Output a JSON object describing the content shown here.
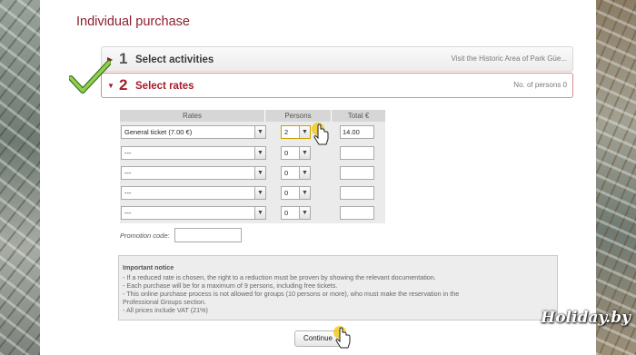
{
  "page_title": "Individual purchase",
  "steps": [
    {
      "number": "1",
      "title": "Select activities",
      "info": "Visit the Historic Area of Park Güe..."
    },
    {
      "number": "2",
      "title": "Select rates",
      "info": "No. of persons 0"
    }
  ],
  "rates_table": {
    "headers": {
      "rates": "Rates",
      "persons": "Persons",
      "total": "Total €"
    },
    "rows": [
      {
        "rate": "General ticket (7.00 €)",
        "persons": "2",
        "total": "14.00"
      },
      {
        "rate": "---",
        "persons": "0",
        "total": ""
      },
      {
        "rate": "---",
        "persons": "0",
        "total": ""
      },
      {
        "rate": "---",
        "persons": "0",
        "total": ""
      },
      {
        "rate": "---",
        "persons": "0",
        "total": ""
      }
    ]
  },
  "promotion": {
    "label": "Promotion code:",
    "value": ""
  },
  "notice": {
    "title": "Important notice",
    "lines": [
      "- If a reduced rate is chosen, the right to a reduction must be proven by showing the relevant documentation.",
      "- Each purchase will be for a maximum of 9 persons, including free tickets.",
      "- This online purchase process is not allowed for groups (10 persons or more), who must make the reservation in the",
      "Professional Groups section.",
      "- All prices include VAT (21%)"
    ]
  },
  "continue_label": "Continue",
  "watermark": "Holiday.by",
  "colors": {
    "accent": "#a51c28",
    "title": "#8f1d2b",
    "check": "#7cc23b"
  },
  "icons": [
    "dropdown-arrow-icon",
    "hand-pointer-icon",
    "green-checkmark-icon",
    "step-arrow-icon"
  ]
}
